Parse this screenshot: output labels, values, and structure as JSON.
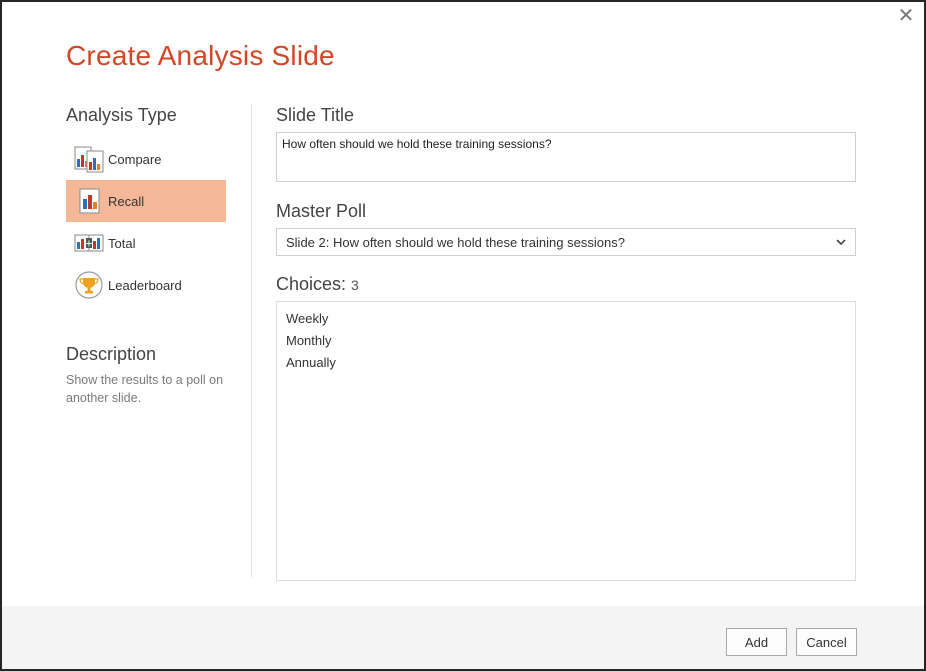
{
  "dialog": {
    "title": "Create Analysis Slide",
    "close_label": "✕"
  },
  "analysis_type": {
    "heading": "Analysis Type",
    "items": [
      {
        "label": "Compare",
        "icon": "compare-chart-icon",
        "selected": false
      },
      {
        "label": "Recall",
        "icon": "recall-chart-icon",
        "selected": true
      },
      {
        "label": "Total",
        "icon": "total-chart-icon",
        "selected": false
      },
      {
        "label": "Leaderboard",
        "icon": "trophy-icon",
        "selected": false
      }
    ]
  },
  "description": {
    "heading": "Description",
    "text": "Show the results to a poll on another slide."
  },
  "slide_title": {
    "label": "Slide Title",
    "value": "How often should we hold these training sessions?"
  },
  "master_poll": {
    "label": "Master Poll",
    "selected": "Slide 2: How often should we hold these training sessions?"
  },
  "choices": {
    "label": "Choices:",
    "count": "3",
    "items": [
      "Weekly",
      "Monthly",
      "Annually"
    ]
  },
  "footer": {
    "add_label": "Add",
    "cancel_label": "Cancel"
  },
  "colors": {
    "accent_title": "#d24726",
    "selected_bg": "#f4b899",
    "footer_bg": "#f4f4f4"
  }
}
